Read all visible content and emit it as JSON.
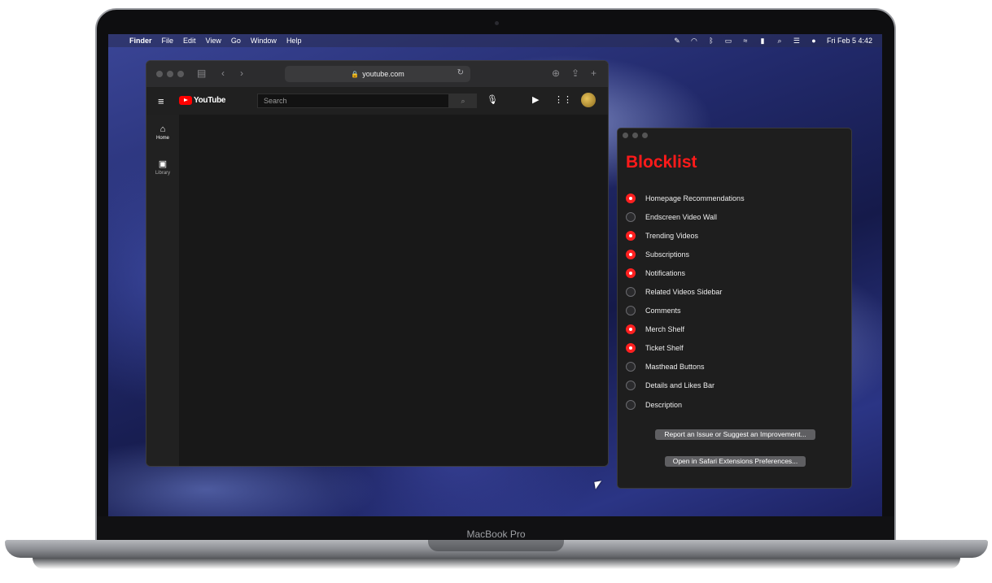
{
  "device": {
    "model_label": "MacBook Pro"
  },
  "menubar": {
    "apple_glyph": "",
    "app_name": "Finder",
    "items": [
      "File",
      "Edit",
      "View",
      "Go",
      "Window",
      "Help"
    ],
    "clock": "Fri Feb 5  4:42"
  },
  "safari": {
    "address": "youtube.com",
    "youtube": {
      "logo_text": "YouTube",
      "search_placeholder": "Search",
      "nav": [
        {
          "label": "Home",
          "icon": "home-icon"
        },
        {
          "label": "Library",
          "icon": "library-icon"
        }
      ]
    }
  },
  "blocklist": {
    "title": "Blocklist",
    "items": [
      {
        "label": "Homepage Recommendations",
        "checked": true
      },
      {
        "label": "Endscreen Video Wall",
        "checked": false
      },
      {
        "label": "Trending Videos",
        "checked": true
      },
      {
        "label": "Subscriptions",
        "checked": true
      },
      {
        "label": "Notifications",
        "checked": true
      },
      {
        "label": "Related Videos Sidebar",
        "checked": false
      },
      {
        "label": "Comments",
        "checked": false
      },
      {
        "label": "Merch Shelf",
        "checked": true
      },
      {
        "label": "Ticket Shelf",
        "checked": true
      },
      {
        "label": "Masthead Buttons",
        "checked": false
      },
      {
        "label": "Details and Likes Bar",
        "checked": false
      },
      {
        "label": "Description",
        "checked": false
      }
    ],
    "report_button": "Report an Issue or Suggest an Improvement...",
    "prefs_button": "Open in Safari Extensions Preferences..."
  },
  "colors": {
    "accent": "#ff1a1a",
    "youtube_red": "#ff0000"
  }
}
